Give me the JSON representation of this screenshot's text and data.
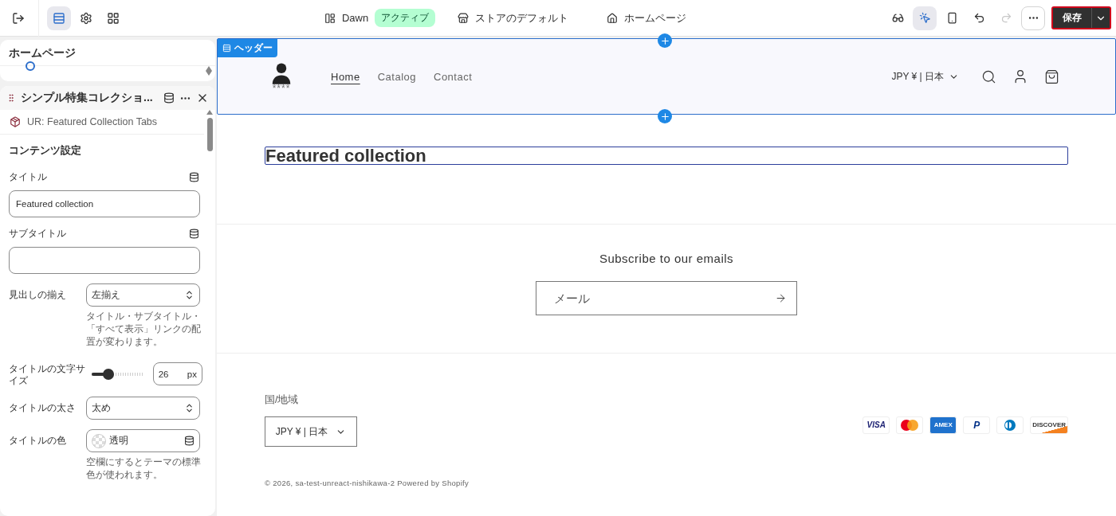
{
  "topbar": {
    "left_tools": [
      {
        "kind": "exit",
        "selected": false
      },
      {
        "kind": "sections",
        "selected": true
      },
      {
        "kind": "settings",
        "selected": false
      },
      {
        "kind": "apps",
        "selected": false
      }
    ],
    "theme": {
      "name": "Dawn",
      "badge": "アクティブ"
    },
    "store": "ストアのデフォルト",
    "page": "ホームページ",
    "right_tools": [
      {
        "kind": "preview",
        "selected": false,
        "disabled": false
      },
      {
        "kind": "inspector",
        "selected": true,
        "disabled": false
      },
      {
        "kind": "mobile",
        "selected": false,
        "disabled": false
      },
      {
        "kind": "undo",
        "selected": false,
        "disabled": false
      },
      {
        "kind": "redo",
        "selected": false,
        "disabled": true
      },
      {
        "kind": "more",
        "selected": false,
        "disabled": false
      }
    ],
    "save": "保存"
  },
  "sidebar": {
    "page_title": "ホームページ",
    "section": {
      "title": "シンプル特集コレクショ...",
      "source": "UR: Featured Collection Tabs",
      "group": "コンテンツ設定",
      "fields": [
        {
          "kind": "text",
          "label": "タイトル",
          "value": "Featured collection",
          "dynamic": true
        },
        {
          "kind": "text",
          "label": "サブタイトル",
          "dynamic": true
        },
        {
          "kind": "select",
          "label": "見出しの揃え",
          "value": "左揃え",
          "help": "タイトル・サブタイトル・「すべて表示」リンクの配置が変わります。"
        },
        {
          "kind": "range",
          "label": "タイトルの文字サイズ",
          "level": 0.33,
          "value": "26",
          "unit": "px"
        },
        {
          "kind": "select",
          "label": "タイトルの太さ",
          "value": "太め"
        },
        {
          "kind": "color",
          "label": "タイトルの色",
          "value": "透明",
          "help": "空欄にするとテーマの標準色が使われます。"
        }
      ]
    }
  },
  "preview": {
    "header": {
      "tag": "ヘッダー",
      "selected": true,
      "logo_caption": "****",
      "nav": [
        {
          "label": "Home",
          "selected": true
        },
        {
          "label": "Catalog",
          "selected": false
        },
        {
          "label": "Contact",
          "selected": false
        }
      ],
      "currency": "JPY ¥ | 日本"
    },
    "featured": {
      "title": "Featured collection",
      "selected": true
    },
    "newsletter": {
      "title": "Subscribe to our emails",
      "placeholder": "メール"
    },
    "footer": {
      "region_label": "国/地域",
      "region_value": "JPY ¥ | 日本",
      "payments": [
        {
          "kind": "visa",
          "label": "VISA"
        },
        {
          "kind": "mastercard"
        },
        {
          "kind": "amex",
          "label": "AMEX"
        },
        {
          "kind": "paypal",
          "label": "P"
        },
        {
          "kind": "diners"
        },
        {
          "kind": "discover",
          "label": "DISCOVER"
        }
      ],
      "copyright": "© 2026, sa-test-unreact-nishikawa-2 Powered by Shopify"
    }
  }
}
